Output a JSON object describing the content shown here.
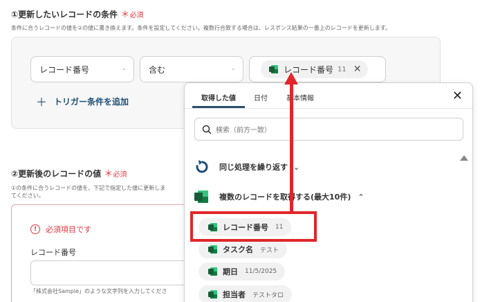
{
  "section1": {
    "title": "①更新したいレコードの条件",
    "required": "必須",
    "description": "条件に合うレコードの値を②の値に書き換えます。条件を設定してください。複数行合致する場合は、レスポンス結果の一番上のレコードを更新します。"
  },
  "condition": {
    "field": "レコード番号",
    "operator": "含む",
    "value_chip": {
      "label": "レコード番号",
      "value": "11"
    },
    "add_trigger": "トリガー条件を追加"
  },
  "section2": {
    "title": "②更新後のレコードの値",
    "required": "必須",
    "description": "①の条件に合うレコードの値を、下記で指定した値に更新しま\nてください。",
    "error": "必須項目です",
    "field_label": "レコード番号",
    "hint": "「株式会社Sample」のような文字列を入力してくださ"
  },
  "popup": {
    "tabs": [
      "取得した値",
      "日付",
      "基本情報"
    ],
    "search_placeholder": "検索（前方一致）",
    "group1": "同じ処理を繰り返す",
    "group2": "複数のレコードを取得する(最大10件)",
    "items": [
      {
        "label": "レコード番号",
        "value": "11"
      },
      {
        "label": "タスク名",
        "value": "テスト"
      },
      {
        "label": "期日",
        "value": "11/5/2025"
      },
      {
        "label": "担当者",
        "value": "テストタロ"
      }
    ]
  },
  "colors": {
    "accent": "#2d4d68",
    "required_red": "#e0383e",
    "highlight_red": "#e0262b",
    "excel_green": "#107c41"
  }
}
